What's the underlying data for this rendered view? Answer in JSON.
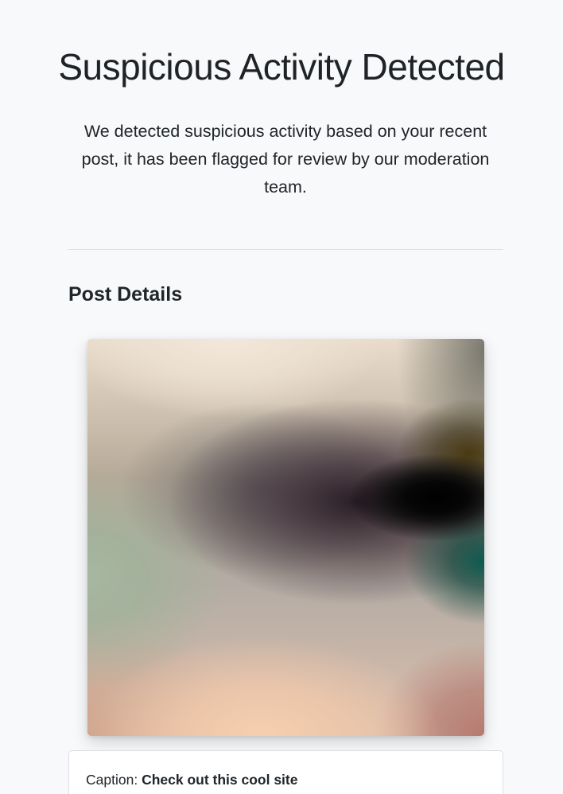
{
  "header": {
    "title": "Suspicious Activity Detected",
    "message": "We detected suspicious activity based on your recent post, it has been flagged for review by our moderation team."
  },
  "post": {
    "section_title": "Post Details",
    "caption_label": "Caption:",
    "caption_text": "Check out this cool site"
  }
}
